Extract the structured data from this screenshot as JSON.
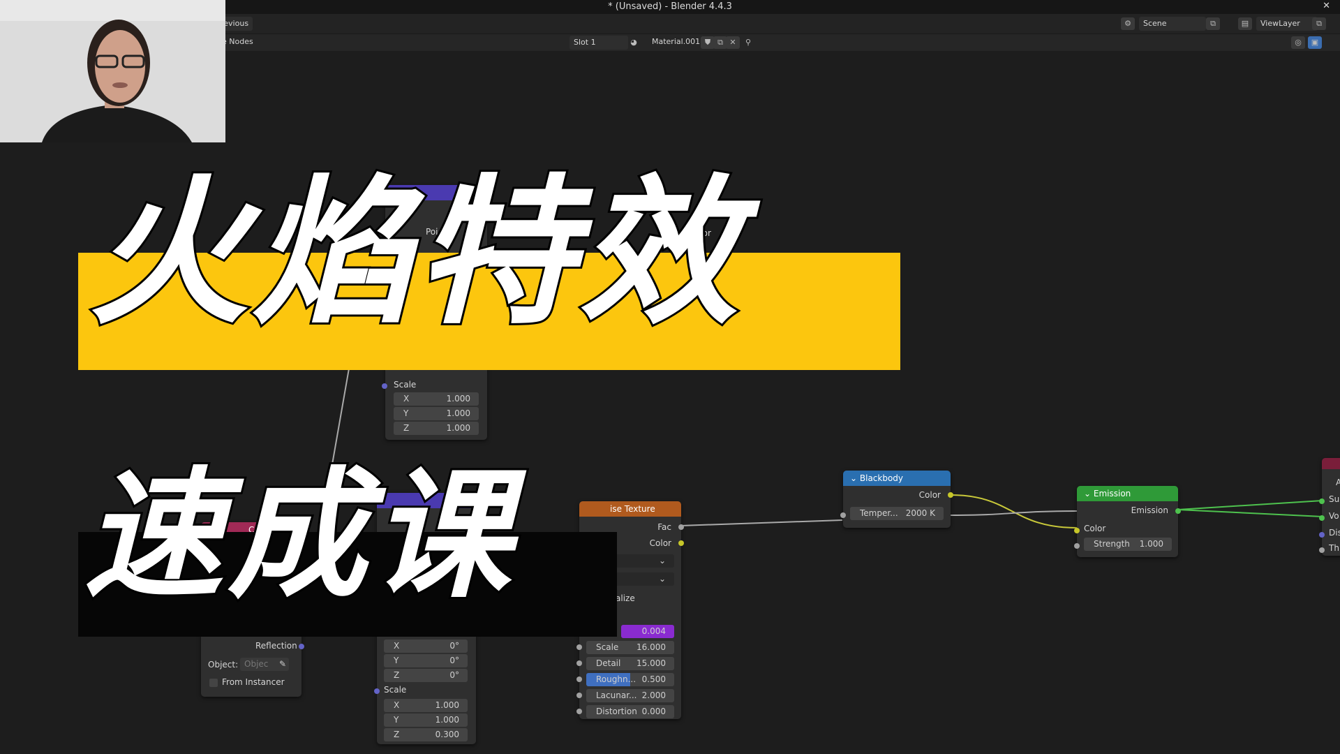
{
  "window": {
    "title": "* (Unsaved) - Blender 4.4.3",
    "close_glyph": "✕"
  },
  "topbar": {
    "previous_label": "revious",
    "scene_label": "Scene",
    "viewlayer_label": "ViewLayer"
  },
  "header": {
    "nodes_label": "e Nodes",
    "slot_label": "Slot 1",
    "material_name": "Material.001"
  },
  "title_overlay": {
    "line1": "火焰特效",
    "line2": "速成课"
  },
  "nodes": {
    "mapping": {
      "partial_header": "Poi",
      "scale_label": "Scale",
      "scale": [
        {
          "axis": "X",
          "value": "1.000"
        },
        {
          "axis": "Y",
          "value": "1.000"
        },
        {
          "axis": "Z",
          "value": "1.000"
        }
      ]
    },
    "vector_label": "ector",
    "texcoord": {
      "partial_header": "Coord",
      "reflection": "Reflection",
      "object_label": "Object:",
      "object_placeholder": "Objec",
      "from_instancer": "From Instancer"
    },
    "vector_transform": {
      "rotation": [
        {
          "axis": "X",
          "value": "0°"
        },
        {
          "axis": "Y",
          "value": "0°"
        },
        {
          "axis": "Z",
          "value": "0°"
        }
      ],
      "scale_label": "Scale",
      "scale": [
        {
          "axis": "X",
          "value": "1.000"
        },
        {
          "axis": "Y",
          "value": "1.000"
        },
        {
          "axis": "Z",
          "value": "0.300"
        }
      ]
    },
    "noise": {
      "header": "ise Texture",
      "fac": "Fac",
      "color": "Color",
      "normalize": "alize",
      "w_value": "0.004",
      "fields": [
        {
          "k": "Scale",
          "v": "16.000"
        },
        {
          "k": "Detail",
          "v": "15.000"
        },
        {
          "k": "Roughn...",
          "v": "0.500"
        },
        {
          "k": "Lacunar...",
          "v": "2.000"
        },
        {
          "k": "Distortion",
          "v": "0.000"
        }
      ]
    },
    "blackbody": {
      "header": "Blackbody",
      "color": "Color",
      "temp_key": "Temper...",
      "temp_value": "2000 K"
    },
    "emission": {
      "header": "Emission",
      "out": "Emission",
      "color": "Color",
      "strength_key": "Strength",
      "strength_value": "1.000"
    },
    "output": {
      "sockets": [
        "Su",
        "Vo",
        "Dis",
        "Th"
      ],
      "partial_letter": "A"
    }
  },
  "colors": {
    "banner_yellow": "#fcc60e",
    "blackbody_header": "#2a6fb0",
    "emission_header": "#2f9a38",
    "noise_header": "#b05a1e",
    "mapping_header": "#4a3ab0",
    "texcoord_header": "#a02a56"
  }
}
